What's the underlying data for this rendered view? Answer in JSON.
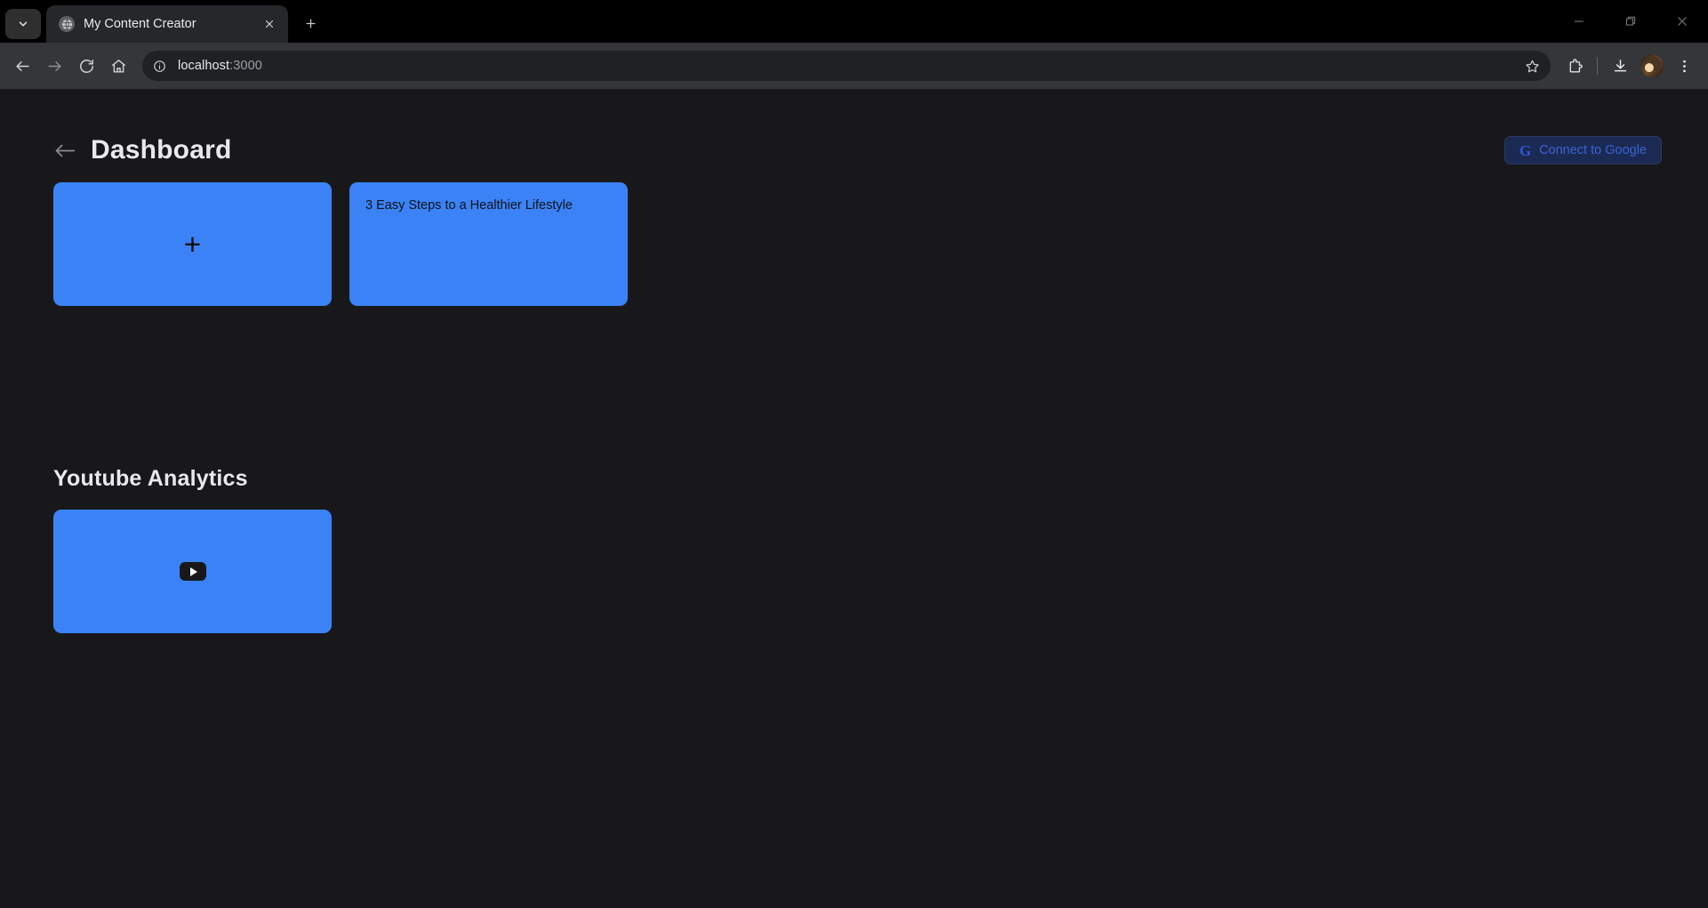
{
  "browser": {
    "tab_search_icon": "chevron-down-icon",
    "tab": {
      "favicon": "globe-icon",
      "title": "My Content Creator",
      "close_icon": "close-icon"
    },
    "new_tab_icon": "plus-icon",
    "window_controls": {
      "minimize": "minimize-icon",
      "maximize": "restore-icon",
      "close": "close-icon"
    },
    "nav": {
      "back_icon": "arrow-left-icon",
      "forward_icon": "arrow-right-icon",
      "reload_icon": "reload-icon",
      "home_icon": "home-icon"
    },
    "omnibox": {
      "info_icon": "info-circle-icon",
      "url_host": "localhost",
      "url_port": ":3000",
      "star_icon": "star-icon"
    },
    "actions": {
      "extensions_icon": "puzzle-piece-icon",
      "downloads_icon": "download-icon",
      "profile_icon": "avatar",
      "menu_icon": "three-dots-vertical-icon"
    }
  },
  "page": {
    "back_icon": "arrow-left-icon",
    "title": "Dashboard",
    "google_button": {
      "logo": "G",
      "label": "Connect to Google"
    },
    "cards": [
      {
        "type": "add",
        "icon": "plus-icon",
        "label": "+"
      },
      {
        "type": "content",
        "label": "3 Easy Steps to a Healthier Lifestyle"
      }
    ],
    "analytics": {
      "title": "Youtube Analytics",
      "card_icon": "youtube-play-icon"
    }
  },
  "colors": {
    "accent_blue": "#3b82f6",
    "page_bg": "#18181b",
    "google_text": "#3b63d8"
  }
}
